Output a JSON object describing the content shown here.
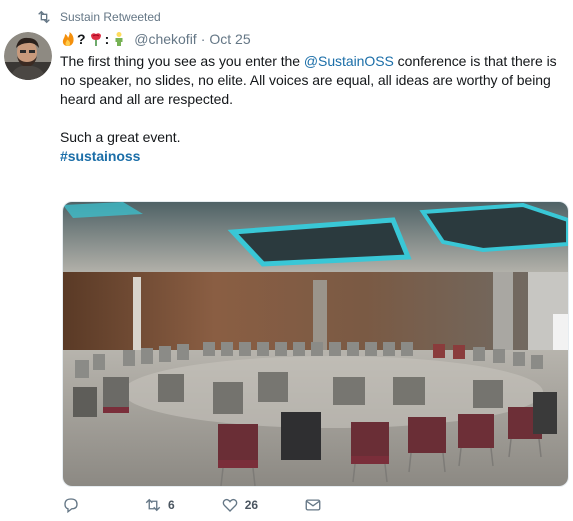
{
  "retweet": {
    "label": "Sustain Retweeted"
  },
  "tweet": {
    "author_handle": "@chekofif",
    "display_name_glyphs": {
      "q": "?",
      "colon": ":"
    },
    "separator": "·",
    "date": "Oct 25",
    "text": {
      "pre": "The first thing you see as you enter the ",
      "mention": "@SustainOSS",
      "post": " conference is that there is no speaker, no slides, no elite. All voices are equal, all ideas are worthy of being heard and all are respected.",
      "para2": "Such a great event.",
      "hashtag": "#sustainoss"
    }
  },
  "actions": {
    "reply": {
      "icon": "reply-icon"
    },
    "retweet": {
      "icon": "retweet-icon",
      "count": "6"
    },
    "like": {
      "icon": "heart-icon",
      "count": "26"
    },
    "message": {
      "icon": "envelope-icon"
    }
  },
  "colors": {
    "link": "#1b6ea8",
    "muted": "#657786",
    "retweet_green": "#17bf63"
  }
}
